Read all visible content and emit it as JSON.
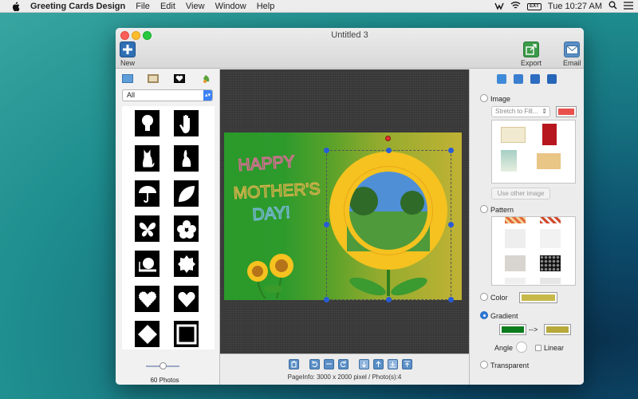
{
  "menubar": {
    "app_name": "Greeting Cards Design",
    "menus": [
      "File",
      "Edit",
      "View",
      "Window",
      "Help"
    ],
    "clock": "Tue 10:27 AM",
    "battery": "EXT"
  },
  "window": {
    "title": "Untitled 3",
    "toolbar": {
      "new_label": "New",
      "export_label": "Export",
      "email_label": "Email"
    }
  },
  "left_panel": {
    "category_icons": [
      "image-icon",
      "frame-icon",
      "mask-icon",
      "leaf-icon"
    ],
    "filter": "All",
    "shapes": [
      "bulb-shape",
      "hand-shape",
      "cat-shape",
      "rabbit-shape",
      "umbrella-shape",
      "leaf-shape",
      "butterfly-shape",
      "flower-shape",
      "snail-shape",
      "seal-shape",
      "heart-rough-shape",
      "heart-shape",
      "diamond-shape",
      "square-frame-shape"
    ],
    "photo_count": "60 Photos",
    "zoom_level": 0.5
  },
  "canvas": {
    "card_text_lines": [
      "HAPPY",
      "MOTHER'S",
      "DAY!"
    ],
    "background_gradient": [
      "#2a9a2a",
      "#c0b234"
    ]
  },
  "bottom_bar": {
    "page_info": "PageInfo: 3000 x 2000 pixel / Photo(s):4"
  },
  "right_panel": {
    "image_label": "Image",
    "fill_mode": "Stretch to Fill...",
    "image_color": "#e8514b",
    "use_other_image": "Use other image",
    "pattern_label": "Pattern",
    "color_label": "Color",
    "color_value": "#c7b84a",
    "gradient_label": "Gradient",
    "gradient_from": "#0b7c1d",
    "gradient_arrow": "-->",
    "gradient_to": "#b7a93a",
    "angle_label": "Angle",
    "linear_label": "Linear",
    "transparent_label": "Transparent",
    "selected": "Gradient"
  }
}
